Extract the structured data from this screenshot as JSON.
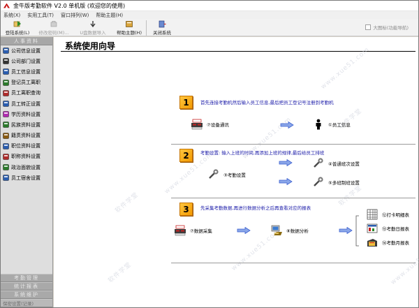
{
  "window": {
    "title": "金牛版考勤软件 V2.0  单机版 (欢迎您的使用)"
  },
  "menu": [
    "系统(X)",
    "实用工具(T)",
    "窗口排列(W)",
    "帮助主题(H)"
  ],
  "toolbar": {
    "login": "登陆系统(L)",
    "change_password": "修改密码(M)...",
    "usb_import": "U盘数据导入",
    "help": "帮助主题(H)",
    "close": "关闭系统",
    "large_icon": "大图标(功能导航)"
  },
  "sidebar": {
    "header": "人事资料",
    "items": [
      {
        "label": "公司信息设置",
        "icon": "building-icon",
        "color": "#2a5db0"
      },
      {
        "label": "公司部门设置",
        "icon": "department-icon",
        "color": "#333333"
      },
      {
        "label": "员工信息设置",
        "icon": "person-icon",
        "color": "#2a5db0"
      },
      {
        "label": "登记员工离职",
        "icon": "leave-icon",
        "color": "#2a7a2a"
      },
      {
        "label": "员工离职查询",
        "icon": "query-icon",
        "color": "#b02a2a"
      },
      {
        "label": "员工转正设置",
        "icon": "regular-icon",
        "color": "#2a5db0"
      },
      {
        "label": "学历资料设置",
        "icon": "education-icon",
        "color": "#b02ab0"
      },
      {
        "label": "民族资料设置",
        "icon": "ethnic-icon",
        "color": "#2a7a2a"
      },
      {
        "label": "籍贯资料设置",
        "icon": "origin-icon",
        "color": "#8a5a10"
      },
      {
        "label": "职位资料设置",
        "icon": "position-icon",
        "color": "#2a5db0"
      },
      {
        "label": "职称资料设置",
        "icon": "title-icon",
        "color": "#b02a2a"
      },
      {
        "label": "政治面貌设置",
        "icon": "politics-icon",
        "color": "#2a7a2a"
      },
      {
        "label": "员工宿舍设置",
        "icon": "dorm-icon",
        "color": "#2a5db0"
      }
    ],
    "footer": [
      "考勤管理",
      "统计报表",
      "系统维护",
      "保密设置(记录)"
    ]
  },
  "main": {
    "title": "系统使用向导",
    "step1": {
      "number": "1",
      "text": "首先连接考勤机然后输入员工信息,最后把员工登记号注册到考勤机",
      "device_comm": "⑦设备通讯",
      "employee_info": "①员工信息"
    },
    "step2": {
      "number": "2",
      "text": "考勤设置: 输入上班的时间,再添加上班的规律,最后给员工排班",
      "attendance_setting": "③考勤设置",
      "normal_shift": "④普通班次设置",
      "multi_shift": "⑤多班制班设置"
    },
    "step3": {
      "number": "3",
      "text": "先采集考勤数据,再进行数据分析之后再查看对应的报表",
      "data_collect": "⑦数据采集",
      "data_analysis": "⑧数据分析",
      "punch_detail": "⑫打卡明细表",
      "daily_report": "⑬考勤日报表",
      "monthly_report": "⑭考勤月报表"
    }
  },
  "watermarks": [
    "软件学堂",
    "www.xue51.com"
  ],
  "colors": {
    "accent_text": "#1a1aa8",
    "step_orange": "#f39a00",
    "arrow_blue": "#3a5fd0"
  }
}
